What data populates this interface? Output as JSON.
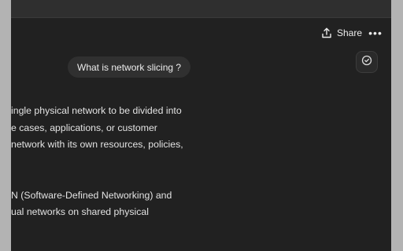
{
  "header": {
    "share_label": "Share",
    "more_label": "•••"
  },
  "conversation": {
    "user_message": "What is network slicing ?",
    "answer_lines": [
      "ingle physical network to be divided into",
      "e cases, applications, or customer",
      "network with its own resources, policies,",
      "N (Software-Defined Networking) and",
      "ual networks on shared physical"
    ]
  },
  "icons": {
    "share": "share-upload-icon",
    "more": "more-horizontal-icon",
    "check": "check-circle-icon"
  },
  "colors": {
    "background": "#212121",
    "top_bar": "#2f2f2f",
    "bubble": "#303030",
    "text": "#e3e3e3"
  }
}
